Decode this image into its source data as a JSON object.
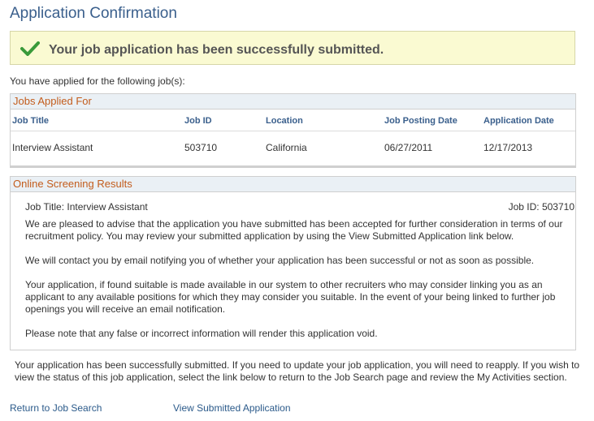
{
  "page": {
    "title": "Application Confirmation"
  },
  "success": {
    "icon": "checkmark-icon",
    "message": "Your job application has been successfully submitted."
  },
  "intro": "You have applied for the following job(s):",
  "jobs_applied": {
    "header": "Jobs Applied For",
    "columns": [
      "Job Title",
      "Job ID",
      "Location",
      "Job Posting Date",
      "Application Date"
    ],
    "rows": [
      [
        "Interview Assistant",
        "503710",
        "California",
        "06/27/2011",
        "12/17/2013"
      ]
    ]
  },
  "screening": {
    "header": "Online Screening Results",
    "job_title_label": "Job Title: Interview Assistant",
    "job_id_label": "Job ID: 503710",
    "paragraphs": [
      "We are pleased to advise that the application you have submitted has been accepted for further consideration in terms of our recruitment policy. You may review your submitted application by using the View Submitted Application link below.",
      "We will contact you by email notifying you of whether your application has been successful or not as soon as possible.",
      "Your application, if found suitable is made available in our system to other recruiters who may consider linking you as an applicant to any available positions for which they may consider you suitable.  In the event of your being linked to further job openings you will receive an email notification.",
      "Please note that any false or incorrect information will render this application void."
    ]
  },
  "footer_text": "Your application has been successfully submitted.  If you need to update your job application, you will need to reapply.  If you wish to view the status of this job application, select the link below to return to the Job Search page and review the My Activities section.",
  "links": {
    "return": "Return to Job Search",
    "view": "View Submitted Application"
  },
  "colors": {
    "title": "#3a5f8c",
    "group_header_text": "#c35c1c",
    "success_bg": "#fafad2",
    "check": "#3a9a3a",
    "link": "#2b5a8a"
  }
}
